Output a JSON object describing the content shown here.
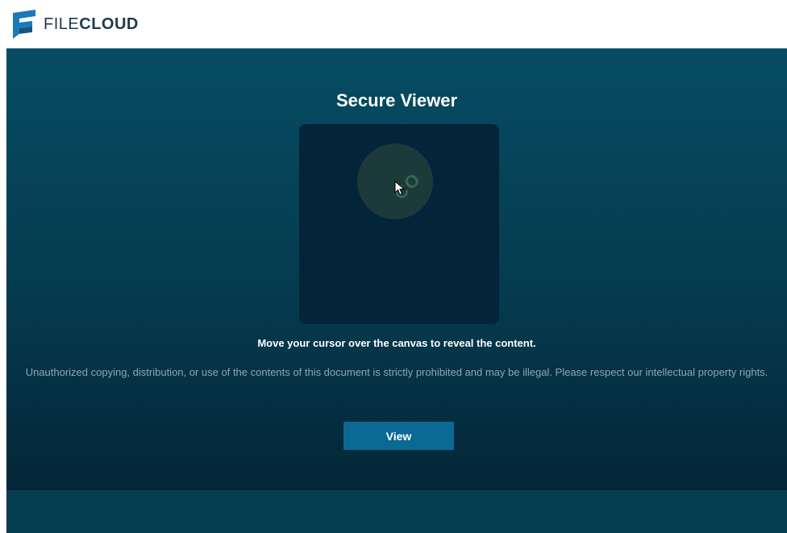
{
  "header": {
    "logo_text_light": "FILE",
    "logo_text_bold": "CLOUD",
    "logo_icon": "filecloud-logo-icon",
    "brand_color": "#1f3a4d",
    "logo_accent": "#1d7ab8"
  },
  "viewer": {
    "title": "Secure Viewer",
    "canvas_revealed_glyph": "CO",
    "instruction": "Move your cursor over the canvas to reveal the content.",
    "notice": "Unauthorized copying, distribution, or use of the contents of this document is strictly prohibited and may be illegal. Please respect our intellectual property rights.",
    "view_button_label": "View",
    "cursor_icon": "mouse-pointer-icon"
  },
  "colors": {
    "stage_top": "#064c63",
    "stage_bottom": "#042638",
    "canvas_bg": "#042439",
    "button_bg": "#0b6a93"
  }
}
